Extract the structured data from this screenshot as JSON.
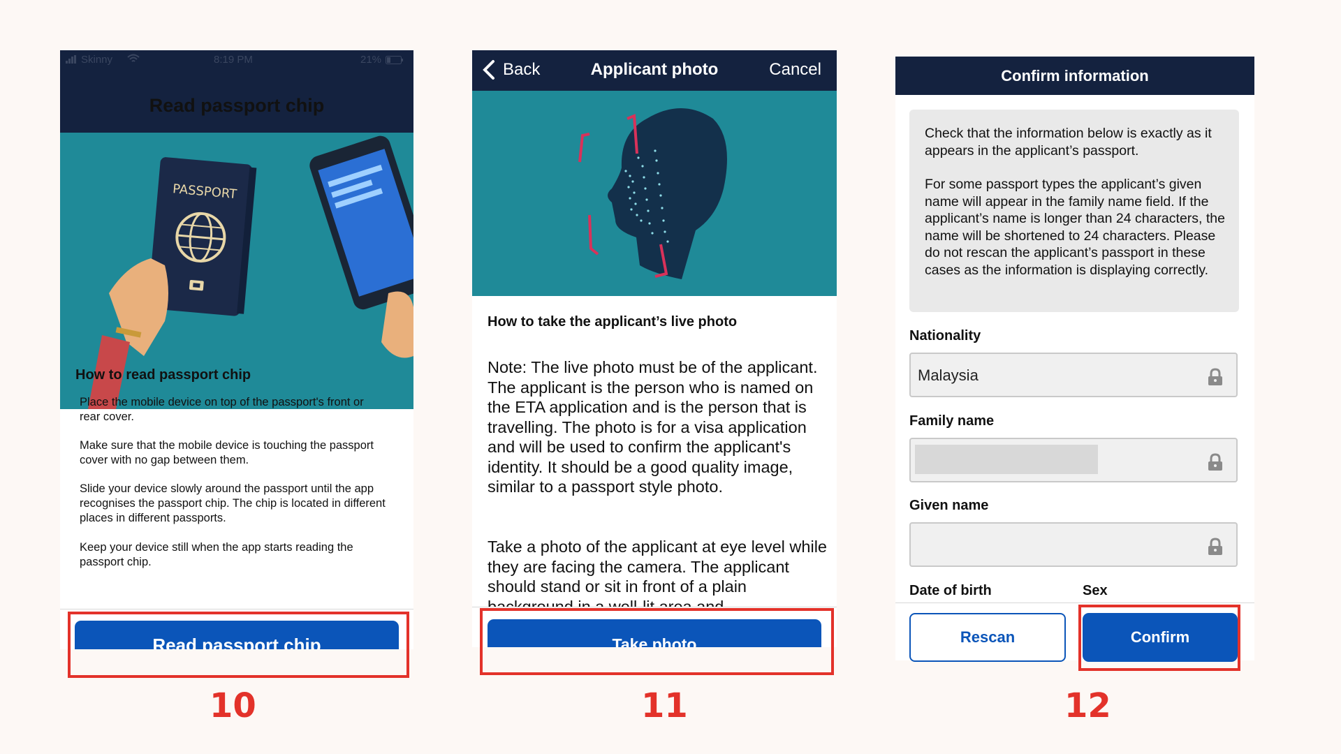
{
  "colors": {
    "brand_navy": "#14223f",
    "primary_blue": "#0b55b9",
    "illustration_teal": "#1f8a98",
    "highlight_red": "#e3322a"
  },
  "screen10": {
    "status_carrier": "Skinny",
    "status_time": "8:19 PM",
    "status_battery": "21%",
    "title": "Read passport chip",
    "passport_text": "PASSPORT",
    "heading": "How to read passport chip",
    "paragraphs": [
      "Place the mobile device on top of the passport's front or rear cover.",
      "Make sure that the mobile device is touching the passport cover with no gap between them.",
      "Slide your device slowly around the passport until the app recognises the passport chip. The chip is located in different places in different passports.",
      "Keep your device still when the app starts reading the passport chip."
    ],
    "button_label": "Read passport chip",
    "step_number": "10"
  },
  "screen11": {
    "back_label": "Back",
    "title": "Applicant photo",
    "cancel_label": "Cancel",
    "heading": "How to take the applicant’s live photo",
    "paragraphs": [
      "Note: The live photo must be of the applicant. The applicant is the person who is named on the ETA application and is the person that is travelling. The photo is for a visa application and will be used to confirm the applicant's identity. It should be a good quality image, similar to a passport style photo.",
      "Take a photo of the applicant at eye level while they are facing the camera. The applicant should stand or sit in front of a plain background in a well-lit area and"
    ],
    "button_label": "Take photo",
    "step_number": "11"
  },
  "screen12": {
    "title": "Confirm information",
    "info_paragraphs": [
      "Check that the information below is exactly as it appears in the applicant’s passport.",
      "For some passport types the applicant’s given name will appear in the family name field. If the applicant’s name is longer than 24 characters, the name will be shortened to 24 characters. Please do not rescan the applicant’s passport in these cases as the information is displaying correctly."
    ],
    "fields": {
      "nationality_label": "Nationality",
      "nationality_value": "Malaysia",
      "family_name_label": "Family name",
      "given_name_label": "Given name",
      "dob_label": "Date of birth",
      "sex_label": "Sex"
    },
    "rescan_label": "Rescan",
    "confirm_label": "Confirm",
    "step_number": "12"
  }
}
